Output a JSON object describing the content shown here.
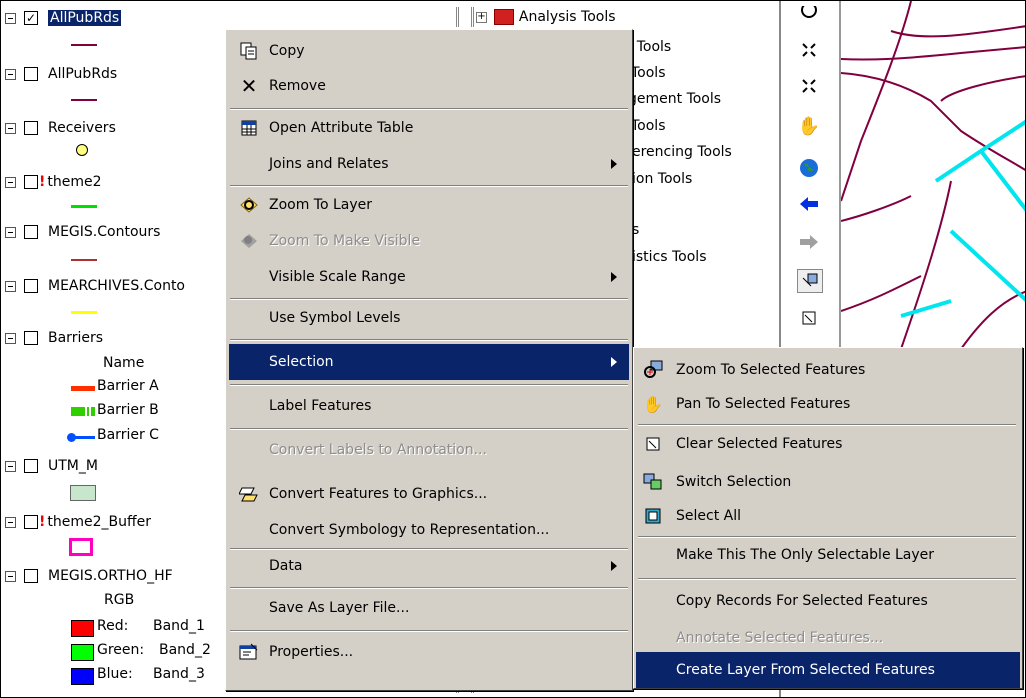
{
  "toc": {
    "layers": [
      {
        "name": "AllPubRds",
        "checked": true,
        "selected": true,
        "warn": false
      },
      {
        "name": "AllPubRds",
        "checked": false,
        "selected": false,
        "warn": false
      },
      {
        "name": "Receivers",
        "checked": false,
        "selected": false,
        "warn": false
      },
      {
        "name": "theme2",
        "checked": false,
        "selected": false,
        "warn": true
      },
      {
        "name": "MEGIS.Contours",
        "checked": false,
        "selected": false,
        "warn": false
      },
      {
        "name": "MEARCHIVES.Conto",
        "checked": false,
        "selected": false,
        "warn": false
      },
      {
        "name": "Barriers",
        "checked": false,
        "selected": false,
        "warn": false
      },
      {
        "name": "UTM_M",
        "checked": false,
        "selected": false,
        "warn": false
      },
      {
        "name": "theme2_Buffer",
        "checked": false,
        "selected": false,
        "warn": true
      },
      {
        "name": "MEGIS.ORTHO_HF",
        "checked": false,
        "selected": false,
        "warn": false
      }
    ],
    "barriers_field": "Name",
    "barriers_legend": [
      "Barrier A",
      "Barrier B",
      "Barrier C"
    ],
    "rgb_label": "RGB",
    "bands": [
      {
        "channel": "Red:",
        "band": "Band_1",
        "color": "#ff0000"
      },
      {
        "channel": "Green:",
        "band": "Band_2",
        "color": "#00ff00"
      },
      {
        "channel": "Blue:",
        "band": "Band_3",
        "color": "#0000ff"
      }
    ]
  },
  "catalog": {
    "items": [
      "Analysis Tools",
      "y Tools",
      "Tools",
      "gement Tools",
      "Tools",
      "erencing Tools",
      "ion Tools",
      "s",
      "istics Tools"
    ]
  },
  "context_menu": {
    "items": [
      {
        "label": "Copy",
        "icon": "copy-icon"
      },
      {
        "label": "Remove",
        "icon": "remove-icon"
      },
      {
        "label": "Open Attribute Table",
        "icon": "table-icon"
      },
      {
        "label": "Joins and Relates",
        "icon": "",
        "submenu": true
      },
      {
        "label": "Zoom To Layer",
        "icon": "zoom-layer-icon"
      },
      {
        "label": "Zoom To Make Visible",
        "icon": "zoom-visible-icon",
        "disabled": true
      },
      {
        "label": "Visible Scale Range",
        "icon": "",
        "submenu": true
      },
      {
        "label": "Use Symbol Levels",
        "icon": ""
      },
      {
        "label": "Selection",
        "icon": "",
        "submenu": true,
        "highlighted": true
      },
      {
        "label": "Label Features",
        "icon": ""
      },
      {
        "label": "Convert Labels to Annotation...",
        "icon": "",
        "disabled": true
      },
      {
        "label": "Convert Features to Graphics...",
        "icon": "convert-graphics-icon"
      },
      {
        "label": "Convert Symbology to Representation...",
        "icon": ""
      },
      {
        "label": "Data",
        "icon": "",
        "submenu": true
      },
      {
        "label": "Save As Layer File...",
        "icon": ""
      },
      {
        "label": "Properties...",
        "icon": "properties-icon"
      }
    ]
  },
  "selection_submenu": {
    "items": [
      {
        "label": "Zoom To Selected Features",
        "icon": "zoom-selected-icon"
      },
      {
        "label": "Pan To Selected Features",
        "icon": "pan-selected-icon"
      },
      {
        "label": "Clear Selected Features",
        "icon": "clear-selected-icon"
      },
      {
        "label": "Switch Selection",
        "icon": "switch-selection-icon"
      },
      {
        "label": "Select All",
        "icon": "select-all-icon"
      },
      {
        "label": "Make This The Only Selectable Layer",
        "icon": ""
      },
      {
        "label": "Copy Records For Selected Features",
        "icon": ""
      },
      {
        "label": "Annotate Selected Features...",
        "icon": "",
        "disabled": true
      },
      {
        "label": "Create Layer From Selected Features",
        "icon": "",
        "highlighted": true
      }
    ]
  },
  "colors": {
    "highlight": "#0a246a",
    "menu_bg": "#d4d0c8",
    "road_line": "#800040",
    "selected_road": "#00e5ee"
  }
}
